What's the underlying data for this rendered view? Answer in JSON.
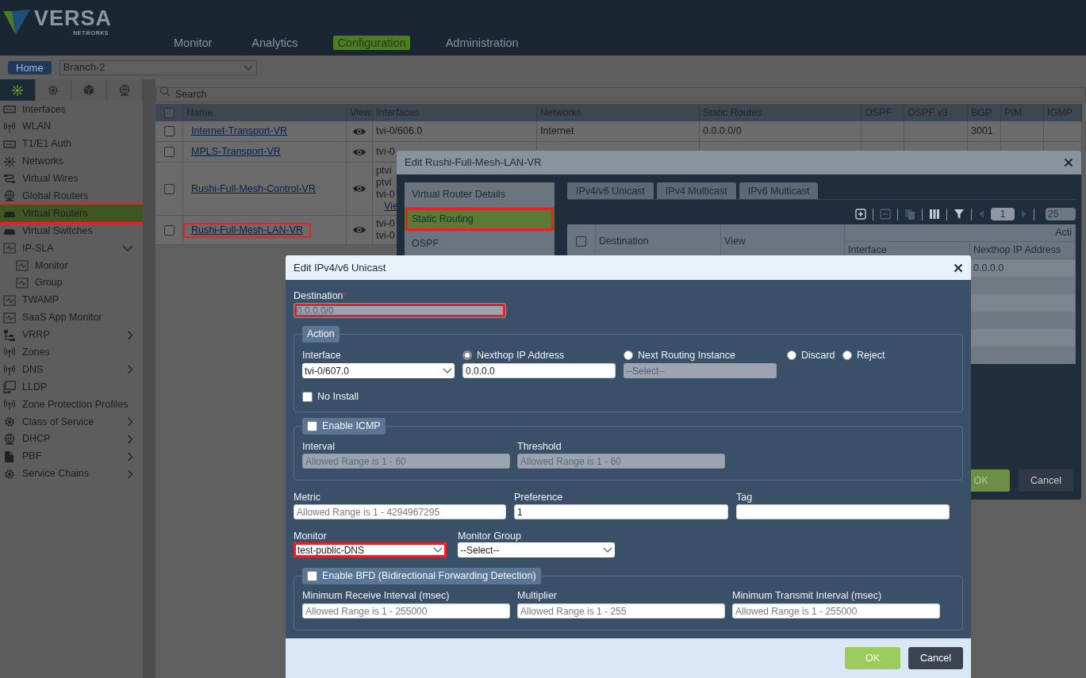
{
  "header": {
    "logo": {
      "brand": "VERSA",
      "tagline": "NETWORKS"
    },
    "nav": [
      {
        "label": "Monitor",
        "selected": false
      },
      {
        "label": "Analytics",
        "selected": false
      },
      {
        "label": "Configuration",
        "selected": true
      },
      {
        "label": "Administration",
        "selected": false
      }
    ]
  },
  "context_bar": {
    "home_button": "Home",
    "branch": "Branch-2"
  },
  "sidebar": {
    "tabs": [
      {
        "selected": true
      },
      {
        "selected": false
      },
      {
        "selected": false
      },
      {
        "selected": false
      }
    ],
    "items": [
      {
        "label": "Interfaces",
        "selected": false,
        "highlighted": false
      },
      {
        "label": "WLAN",
        "selected": false,
        "highlighted": false
      },
      {
        "label": "T1/E1 Auth",
        "selected": false,
        "highlighted": false
      },
      {
        "label": "Networks",
        "selected": false,
        "highlighted": false
      },
      {
        "label": "Virtual Wires",
        "selected": false,
        "highlighted": false
      },
      {
        "label": "Global Routers",
        "selected": false,
        "highlighted": false
      },
      {
        "label": "Virtual Routers",
        "selected": true,
        "highlighted": true
      },
      {
        "label": "Virtual Switches",
        "selected": false,
        "highlighted": false
      },
      {
        "label": "IP-SLA",
        "selected": false,
        "highlighted": false,
        "expanded": true,
        "children": [
          {
            "label": "Monitor",
            "selected": false,
            "highlighted": false
          },
          {
            "label": "Group",
            "selected": false,
            "highlighted": false
          }
        ]
      },
      {
        "label": "TWAMP",
        "selected": false,
        "highlighted": false
      },
      {
        "label": "SaaS App Monitor",
        "selected": false,
        "highlighted": false
      },
      {
        "label": "VRRP",
        "selected": false,
        "highlighted": false,
        "expanded": false
      },
      {
        "label": "Zones",
        "selected": false,
        "highlighted": false
      },
      {
        "label": "DNS",
        "selected": false,
        "highlighted": false,
        "expanded": false
      },
      {
        "label": "LLDP",
        "selected": false,
        "highlighted": false
      },
      {
        "label": "Zone Protection Profiles",
        "selected": false,
        "highlighted": false
      },
      {
        "label": "Class of Service",
        "selected": false,
        "highlighted": false,
        "expanded": false
      },
      {
        "label": "DHCP",
        "selected": false,
        "highlighted": false,
        "expanded": false
      },
      {
        "label": "PBF",
        "selected": false,
        "highlighted": false,
        "expanded": false
      },
      {
        "label": "Service Chains",
        "selected": false,
        "highlighted": false,
        "expanded": false
      }
    ]
  },
  "search": {
    "placeholder": "Search"
  },
  "table": {
    "select_all": {
      "checked": false
    },
    "columns": [
      "Name",
      "View",
      "Interfaces",
      "Networks",
      "Static Routes",
      "OSPF",
      "OSPF v3",
      "BGP",
      "PIM",
      "IGMP"
    ],
    "rows": [
      {
        "checked": false,
        "name": "Internet-Transport-VR",
        "highlighted": false,
        "interfaces": [
          "tvi-0/606.0"
        ],
        "networks": "Internet",
        "static_routes": "0.0.0.0/0",
        "bgp": "3001"
      },
      {
        "checked": false,
        "name": "MPLS-Transport-VR",
        "highlighted": false,
        "interfaces": [
          "tvi-0"
        ]
      },
      {
        "checked": false,
        "name": "Rushi-Full-Mesh-Control-VR",
        "highlighted": false,
        "interfaces": [
          "ptvi",
          "ptvi",
          "tvi-0"
        ],
        "view_link": "Vie"
      },
      {
        "checked": false,
        "name": "Rushi-Full-Mesh-LAN-VR",
        "highlighted": true,
        "interfaces": [
          "tvi-0",
          "tvi-0"
        ]
      }
    ]
  },
  "router_dialog": {
    "title": "Edit Rushi-Full-Mesh-LAN-VR",
    "nav": [
      {
        "label": "Virtual Router Details",
        "selected": false,
        "highlighted": false
      },
      {
        "label": "Static Routing",
        "selected": true,
        "highlighted": true
      },
      {
        "label": "OSPF",
        "selected": false,
        "highlighted": false
      }
    ],
    "tabs": [
      "IPv4/v6 Unicast",
      "IPv4 Multicast",
      "IPv6 Multicast"
    ],
    "pagination": {
      "page": "1",
      "page_size": "25"
    },
    "table": {
      "select_all": {
        "checked": false
      },
      "columns": [
        "Destination",
        "View"
      ],
      "group": "Acti",
      "subcolumns": [
        "Interface",
        "Nexthop IP Address"
      ],
      "rows": [
        {
          "nexthop": "0.0.0.0"
        }
      ]
    },
    "buttons": [
      {
        "label": "OK",
        "kind": "primary"
      },
      {
        "label": "Cancel",
        "kind": "secondary"
      }
    ]
  },
  "route_dialog": {
    "title": "Edit IPv4/v6 Unicast",
    "destination": {
      "label": "Destination",
      "required_mark": "*",
      "value": "0.0.0.0/0",
      "disabled": true,
      "highlighted": true
    },
    "action": {
      "legend": "Action",
      "interface": {
        "label": "Interface",
        "value": "tvi-0/607.0"
      },
      "options": [
        {
          "label": "Nexthop IP Address",
          "selected": true,
          "kind": "input",
          "value": "0.0.0.0"
        },
        {
          "label": "Next Routing Instance",
          "selected": false,
          "kind": "select",
          "value": "--Select--",
          "disabled": true
        },
        {
          "label": "Discard",
          "selected": false
        },
        {
          "label": "Reject",
          "selected": false
        }
      ],
      "no_install": {
        "label": "No Install",
        "checked": false
      }
    },
    "icmp": {
      "legend": "Enable ICMP",
      "checked": false,
      "fields": [
        {
          "label": "Interval",
          "placeholder": "Allowed Range is 1 - 60",
          "disabled": true
        },
        {
          "label": "Threshold",
          "placeholder": "Allowed Range is 1 - 60",
          "disabled": true
        }
      ]
    },
    "metrics": [
      {
        "label": "Metric",
        "placeholder": "Allowed Range is 1 - 4294967295"
      },
      {
        "label": "Preference",
        "value": "1"
      },
      {
        "label": "Tag"
      }
    ],
    "monitor": {
      "label": "Monitor",
      "value": "test-public-DNS",
      "highlighted": true
    },
    "monitor_group": {
      "label": "Monitor Group",
      "value": "--Select--"
    },
    "bfd": {
      "legend": "Enable BFD (Bidirectional Forwarding Detection)",
      "checked": false,
      "fields": [
        {
          "label": "Minimum Receive Interval (msec)",
          "placeholder": "Allowed Range is 1 - 255000"
        },
        {
          "label": "Multiplier",
          "placeholder": "Allowed Range is 1 - 255"
        },
        {
          "label": "Minimum Transmit Interval (msec)",
          "placeholder": "Allowed Range is 1 - 255000"
        }
      ]
    },
    "buttons": [
      {
        "label": "OK",
        "kind": "primary"
      },
      {
        "label": "Cancel",
        "kind": "secondary"
      }
    ]
  }
}
